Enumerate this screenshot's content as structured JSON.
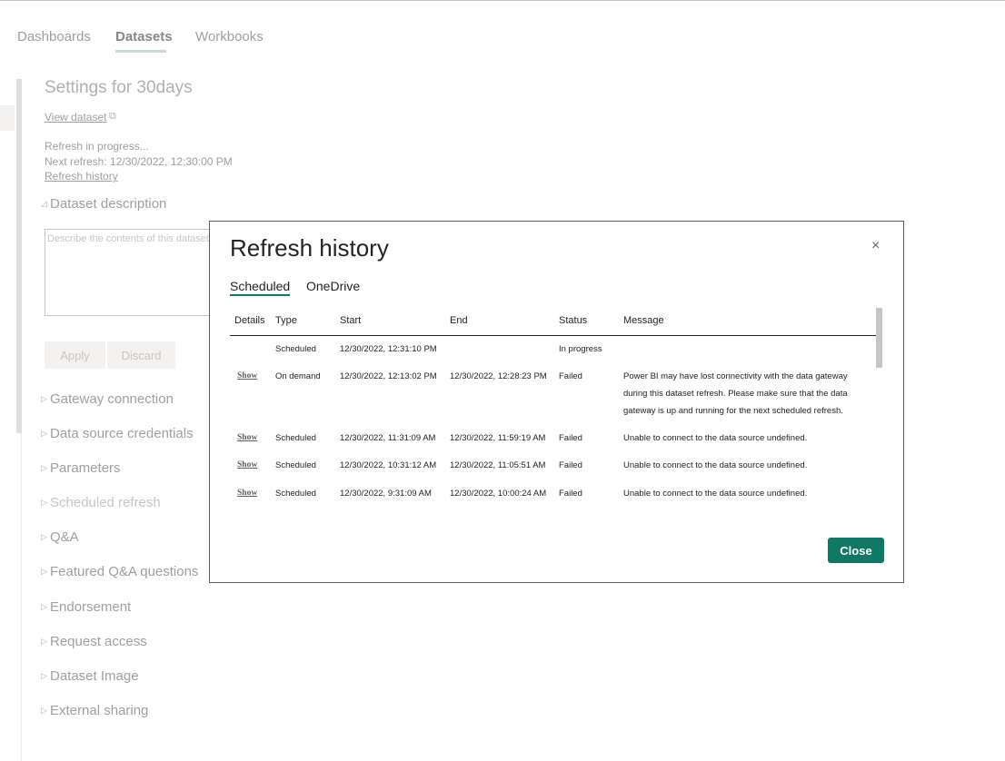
{
  "top_tabs": [
    {
      "label": "Dashboards",
      "active": false
    },
    {
      "label": "Datasets",
      "active": true
    },
    {
      "label": "Workbooks",
      "active": false
    }
  ],
  "settings": {
    "title": "Settings for 30days",
    "view_dataset": "View dataset",
    "status_line": "Refresh in progress...",
    "next_refresh": "Next refresh: 12/30/2022, 12:30:00 PM",
    "refresh_history_link": "Refresh history",
    "description_placeholder": "Describe the contents of this dataset.",
    "apply_label": "Apply",
    "discard_label": "Discard",
    "sections": [
      "Dataset description",
      "Gateway connection",
      "Data source credentials",
      "Parameters",
      "Scheduled refresh",
      "Q&A",
      "Featured Q&A questions",
      "Endorsement",
      "Request access",
      "Dataset Image",
      "External sharing"
    ]
  },
  "modal": {
    "title": "Refresh history",
    "close_symbol": "×",
    "tabs": [
      {
        "label": "Scheduled",
        "active": true
      },
      {
        "label": "OneDrive",
        "active": false
      }
    ],
    "columns": [
      "Details",
      "Type",
      "Start",
      "End",
      "Status",
      "Message"
    ],
    "rows": [
      {
        "details": "",
        "type": "Scheduled",
        "start": "12/30/2022, 12:31:10 PM",
        "end": "",
        "status": "In progress",
        "message": ""
      },
      {
        "details": "Show",
        "type": "On demand",
        "start": "12/30/2022, 12:13:02 PM",
        "end": "12/30/2022, 12:28:23 PM",
        "status": "Failed",
        "message": "Power BI may have lost connectivity with the data gateway during this dataset refresh. Please make sure that the data gateway is up and running for the next scheduled refresh."
      },
      {
        "details": "Show",
        "type": "Scheduled",
        "start": "12/30/2022, 11:31:09 AM",
        "end": "12/30/2022, 11:59:19 AM",
        "status": "Failed",
        "message": "Unable to connect to the data source undefined."
      },
      {
        "details": "Show",
        "type": "Scheduled",
        "start": "12/30/2022, 10:31:12 AM",
        "end": "12/30/2022, 11:05:51 AM",
        "status": "Failed",
        "message": "Unable to connect to the data source undefined."
      },
      {
        "details": "Show",
        "type": "Scheduled",
        "start": "12/30/2022, 9:31:09 AM",
        "end": "12/30/2022, 10:00:24 AM",
        "status": "Failed",
        "message": "Unable to connect to the data source undefined."
      }
    ],
    "close_button": "Close"
  },
  "colors": {
    "accent": "#117865",
    "text": "#252423",
    "muted": "#a19f9d"
  }
}
